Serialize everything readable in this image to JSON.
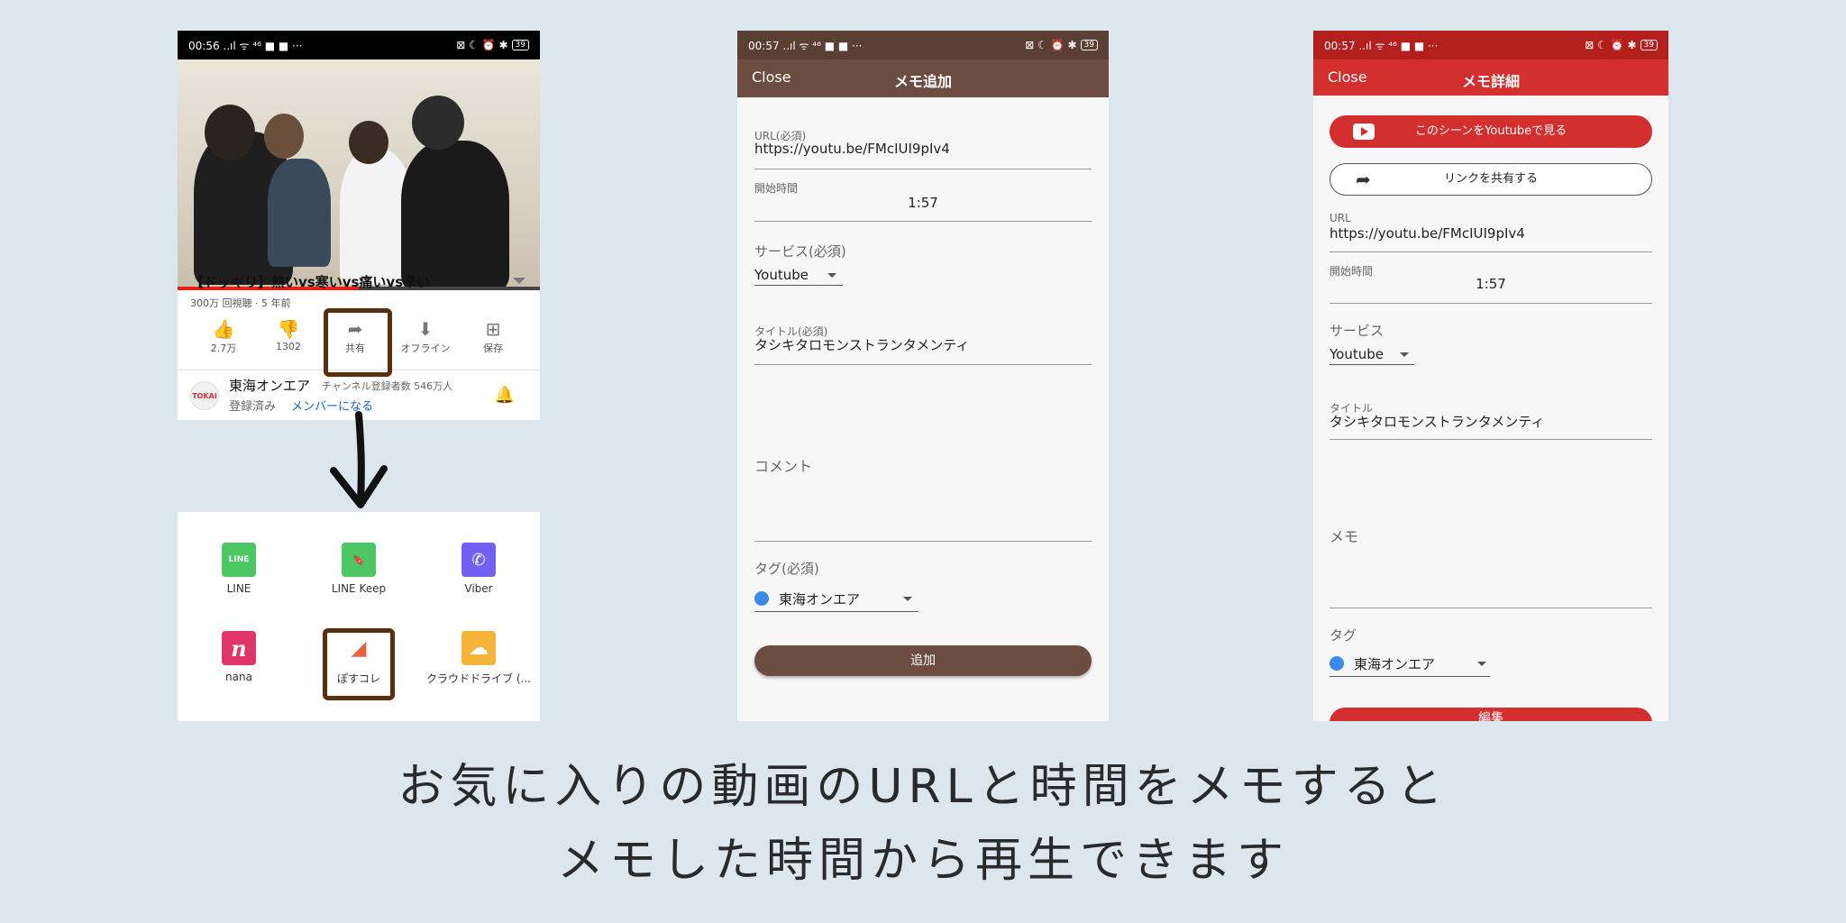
{
  "youtube": {
    "status": {
      "time": "00:56",
      "icons": "..ıl ᯤ ⁴⁶ ■ ■ ···",
      "right": "⊠ ☾ ⏰ ✱",
      "battery": "39"
    },
    "video_title": "【ドッキリ】熱いvs寒いvs痛いvs辛い",
    "meta": "300万 回視聴 · 5 年前",
    "watch_progress": 0.5,
    "actions": [
      {
        "icon": "thumbs-up-icon",
        "glyph": "👍",
        "label": "2.7万"
      },
      {
        "icon": "thumbs-down-icon",
        "glyph": "👎",
        "label": "1302"
      },
      {
        "icon": "share-icon",
        "glyph": "➦",
        "label": "共有"
      },
      {
        "icon": "download-icon",
        "glyph": "⬇",
        "label": "オフライン"
      },
      {
        "icon": "save-icon",
        "glyph": "⊞",
        "label": "保存"
      }
    ],
    "channel": {
      "name": "東海オンエア",
      "subs": "チャンネル登録者数 546万人",
      "registered": "登録済み",
      "member": "メンバーになる",
      "bell": "🔔",
      "logo_text": "TOKAI"
    }
  },
  "share_sheet": {
    "apps": [
      {
        "label": "LINE",
        "icon": "line-icon",
        "color": "#4cc764",
        "glyph": "LINE"
      },
      {
        "label": "LINE Keep",
        "icon": "bookmark-icon",
        "color": "#4cc764",
        "glyph": "🔖"
      },
      {
        "label": "Viber",
        "icon": "viber-icon",
        "color": "#7360f2",
        "glyph": "✆"
      },
      {
        "label": "nana",
        "icon": "nana-icon",
        "color": "#e0356a",
        "glyph": "n"
      },
      {
        "label": "ぽすコレ",
        "icon": "poscolle-icon",
        "color": "#ffffff",
        "glyph": "◢"
      },
      {
        "label": "クラウドドライブ (...",
        "icon": "cloud-icon",
        "color": "#f6b33a",
        "glyph": "☁"
      }
    ]
  },
  "memo_add": {
    "status": {
      "time": "00:57",
      "icons": "..ıl ᯤ ⁴⁶ ■ ■ ···",
      "right": "⊠ ☾ ⏰ ✱",
      "battery": "39"
    },
    "header": {
      "close": "Close",
      "title": "メモ追加"
    },
    "url": {
      "label": "URL(必須)",
      "value": "https://youtu.be/FMcIUI9pIv4"
    },
    "start": {
      "label": "開始時間",
      "value": "1:57"
    },
    "service": {
      "label": "サービス(必須)",
      "value": "Youtube"
    },
    "title": {
      "label": "タイトル(必須)",
      "value": "タシキタロモンストランタメンティ"
    },
    "comment": {
      "label": "コメント"
    },
    "tag": {
      "label": "タグ(必須)",
      "value": "東海オンエア",
      "color": "#3b8beb"
    },
    "submit": "追加",
    "accent": "#6d4c41"
  },
  "memo_detail": {
    "status": {
      "time": "00:57",
      "icons": "..ıl ᯤ ⁴⁶ ■ ■ ···",
      "right": "⊠ ☾ ⏰ ✱",
      "battery": "39"
    },
    "header": {
      "close": "Close",
      "title": "メモ詳細"
    },
    "watch_button": "このシーンをYoutubeで見る",
    "share_button": "リンクを共有する",
    "url": {
      "label": "URL",
      "value": "https://youtu.be/FMcIUI9pIv4"
    },
    "start": {
      "label": "開始時間",
      "value": "1:57"
    },
    "service": {
      "label": "サービス",
      "value": "Youtube"
    },
    "title": {
      "label": "タイトル",
      "value": "タシキタロモンストランタメンティ"
    },
    "memo": {
      "label": "メモ"
    },
    "tag": {
      "label": "タグ",
      "value": "東海オンエア",
      "color": "#3b8beb"
    },
    "edit_button": "編集",
    "accent": "#d32f2f"
  },
  "caption": {
    "line1": "お気に入りの動画のURLと時間をメモすると",
    "line2": "メモした時間から再生できます"
  }
}
